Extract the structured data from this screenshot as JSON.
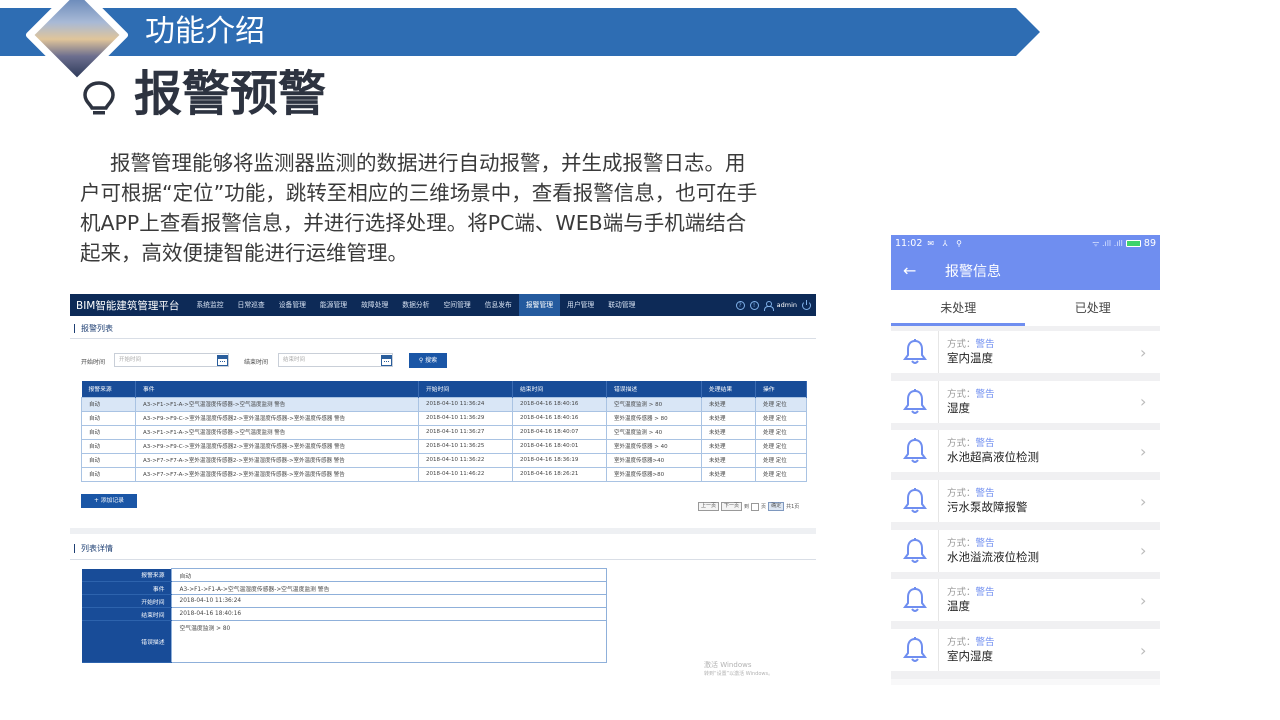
{
  "slide": {
    "banner_title": "功能介绍",
    "heading": "报警预警",
    "intro": "报警管理能够将监测器监测的数据进行自动报警，并生成报警日志。用户可根据“定位”功能，跳转至相应的三维场景中，查看报警信息，也可在手机APP上查看报警信息，并进行选择处理。将PC端、WEB端与手机端结合起来，高效便捷智能进行运维管理。"
  },
  "pc_app": {
    "brand": "BIM智能建筑管理平台",
    "nav": [
      "系统监控",
      "日常巡查",
      "设备管理",
      "能源管理",
      "故障处理",
      "数据分析",
      "空间管理",
      "信息发布",
      "报警管理",
      "用户管理",
      "联动管理"
    ],
    "active_nav": "报警管理",
    "top_right": {
      "help": "?",
      "info": "!",
      "user": "admin"
    },
    "list_title": "报警列表",
    "filter": {
      "start_label": "开始时间",
      "start_placeholder": "开始时间",
      "end_label": "结束时间",
      "end_placeholder": "结束时间",
      "search_label": "搜索"
    },
    "table": {
      "headers": [
        "报警来源",
        "事件",
        "开始时间",
        "结束时间",
        "错误描述",
        "处理结果",
        "操作"
      ],
      "rows": [
        [
          "自动",
          "A3->F1->F1-A->空气温湿度传感器->空气温度监测 警告",
          "2018-04-10 11:36:24",
          "2018-04-16 18:40:16",
          "空气温度监测 > 80",
          "未处理",
          "处理 定位"
        ],
        [
          "自动",
          "A3->F9->F9-C->室外温湿度传感器2->室外温湿度传感器->室外温度传感器 警告",
          "2018-04-10 11:36:29",
          "2018-04-16 18:40:16",
          "室外温度传感器 > 80",
          "未处理",
          "处理 定位"
        ],
        [
          "自动",
          "A3->F1->F1-A->空气温湿度传感器->空气温度监测 警告",
          "2018-04-10 11:36:27",
          "2018-04-16 18:40:07",
          "空气温度监测 > 40",
          "未处理",
          "处理 定位"
        ],
        [
          "自动",
          "A3->F9->F9-C->室外温湿度传感器2->室外温湿度传感器->室外温度传感器 警告",
          "2018-04-10 11:36:25",
          "2018-04-16 18:40:01",
          "室外温度传感器 > 40",
          "未处理",
          "处理 定位"
        ],
        [
          "自动",
          "A3->F7->F7-A->室外温湿度传感器2->室外温湿度传感器->室外温度传感器 警告",
          "2018-04-10 11:36:22",
          "2018-04-16 18:36:19",
          "室外温度传感器>40",
          "未处理",
          "处理 定位"
        ],
        [
          "自动",
          "A3->F7->F7-A->室外温湿度传感器2->室外温湿度传感器->室外温度传感器 警告",
          "2018-04-10 11:46:22",
          "2018-04-16 18:26:21",
          "室外温度传感器>80",
          "未处理",
          "处理 定位"
        ]
      ]
    },
    "add_button": "添加记录",
    "pager": {
      "prev": "上一页",
      "next": "下一页",
      "goto": "到",
      "page_unit": "页",
      "confirm": "确定",
      "total": "共1页"
    },
    "detail_title": "列表详情",
    "detail": [
      {
        "label": "报警来源",
        "value": "自动"
      },
      {
        "label": "事件",
        "value": "A3->F1->F1-A->空气温湿度传感器->空气温度监测 警告"
      },
      {
        "label": "开始时间",
        "value": "2018-04-10 11:36:24"
      },
      {
        "label": "结束时间",
        "value": "2018-04-16 18:40:16"
      },
      {
        "label": "错误描述",
        "value": "空气温度监测 > 80"
      }
    ],
    "watermark_line1": "激活 Windows",
    "watermark_line2": "转到“设置”以激活 Windows。"
  },
  "mobile": {
    "time": "11:02",
    "status_left_icons": "✉ ⅄ ⚲",
    "signal": "ᯤ .ıll .ıll",
    "battery": "89",
    "title": "报警信息",
    "tabs": [
      "未处理",
      "已处理"
    ],
    "active_tab": "未处理",
    "mode_label": "方式：",
    "items": [
      {
        "mode": "警告",
        "name": "室内温度"
      },
      {
        "mode": "警告",
        "name": "湿度"
      },
      {
        "mode": "警告",
        "name": "水池超高液位检测"
      },
      {
        "mode": "警告",
        "name": "污水泵故障报警"
      },
      {
        "mode": "警告",
        "name": "水池溢流液位检测"
      },
      {
        "mode": "警告",
        "name": "温度"
      },
      {
        "mode": "警告",
        "name": "室内湿度"
      }
    ],
    "accent_color": "#6f8ef0"
  }
}
